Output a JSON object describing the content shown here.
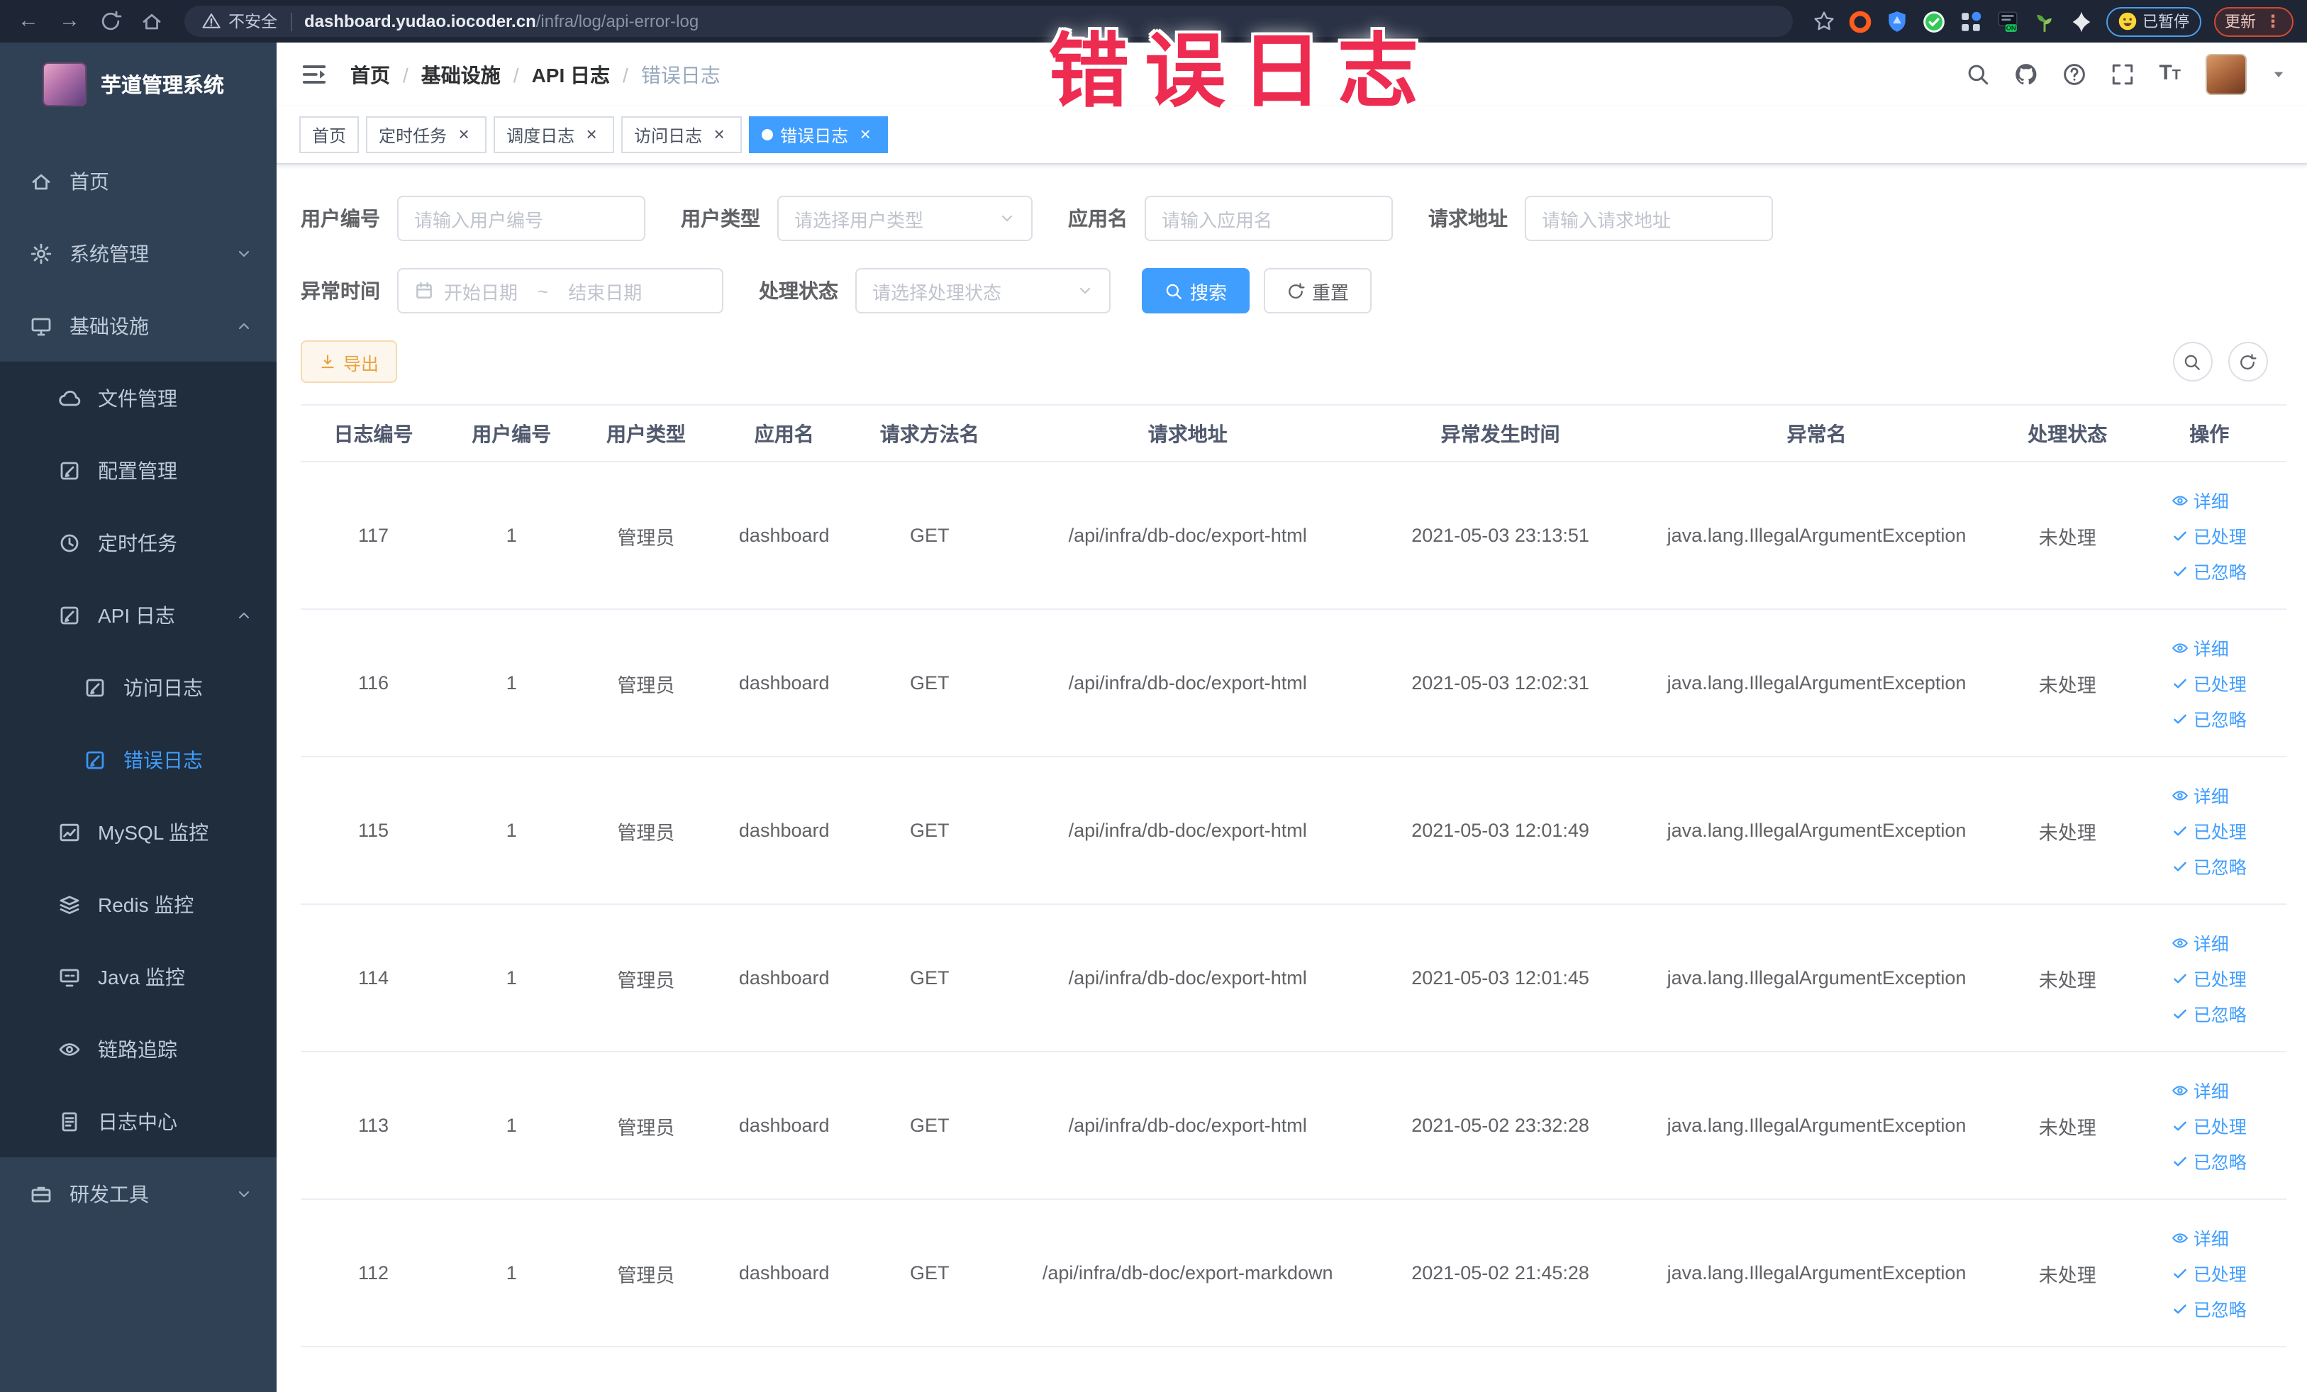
{
  "browser": {
    "security_label": "不安全",
    "url_host": "dashboard.yudao.iocoder.cn",
    "url_path": "/infra/log/api-error-log",
    "paused_label": "已暂停",
    "update_label": "更新"
  },
  "annotation": {
    "text": "错误日志",
    "color": "#ee2b50"
  },
  "sidebar": {
    "title": "芋道管理系统",
    "items": [
      {
        "label": "首页",
        "icon": "home-icon",
        "level": 0
      },
      {
        "label": "系统管理",
        "icon": "gear-icon",
        "level": 0,
        "arrow_down": true
      },
      {
        "label": "基础设施",
        "icon": "infra-icon",
        "level": 0,
        "arrow_up": true
      },
      {
        "label": "文件管理",
        "icon": "file-icon",
        "level": 1,
        "sub": true
      },
      {
        "label": "配置管理",
        "icon": "config-icon",
        "level": 1,
        "sub": true
      },
      {
        "label": "定时任务",
        "icon": "job-icon",
        "level": 1,
        "sub": true
      },
      {
        "label": "API 日志",
        "icon": "apilog-icon",
        "level": 1,
        "sub": true,
        "arrow_up": true
      },
      {
        "label": "访问日志",
        "icon": "accesslog-icon",
        "level": 2,
        "sub": true
      },
      {
        "label": "错误日志",
        "icon": "errorlog-icon",
        "level": 2,
        "sub": true,
        "active": true
      },
      {
        "label": "MySQL 监控",
        "icon": "mysql-icon",
        "level": 1,
        "sub": true
      },
      {
        "label": "Redis 监控",
        "icon": "redis-icon",
        "level": 1,
        "sub": true
      },
      {
        "label": "Java 监控",
        "icon": "java-icon",
        "level": 1,
        "sub": true
      },
      {
        "label": "链路追踪",
        "icon": "trace-icon",
        "level": 1,
        "sub": true
      },
      {
        "label": "日志中心",
        "icon": "logcenter-icon",
        "level": 1,
        "sub": true
      },
      {
        "label": "研发工具",
        "icon": "tool-icon",
        "level": 0,
        "arrow_down": true
      }
    ]
  },
  "header": {
    "breadcrumb": [
      {
        "label": "首页",
        "sep": true
      },
      {
        "label": "基础设施",
        "sep": true
      },
      {
        "label": "API 日志",
        "sep": true
      },
      {
        "label": "错误日志",
        "last": true
      }
    ]
  },
  "tabs": [
    {
      "label": "首页"
    },
    {
      "label": "定时任务",
      "closable": true
    },
    {
      "label": "调度日志",
      "closable": true
    },
    {
      "label": "访问日志",
      "closable": true
    },
    {
      "label": "错误日志",
      "closable": true,
      "active": true
    }
  ],
  "filters": {
    "user_id": {
      "label": "用户编号",
      "placeholder": "请输入用户编号"
    },
    "user_type": {
      "label": "用户类型",
      "placeholder": "请选择用户类型"
    },
    "app_name": {
      "label": "应用名",
      "placeholder": "请输入应用名"
    },
    "request_url": {
      "label": "请求地址",
      "placeholder": "请输入请求地址"
    },
    "exception_time": {
      "label": "异常时间",
      "start_placeholder": "开始日期",
      "separator": "~",
      "end_placeholder": "结束日期"
    },
    "process_status": {
      "label": "处理状态",
      "placeholder": "请选择处理状态"
    },
    "search_label": "搜索",
    "reset_label": "重置"
  },
  "toolbar": {
    "export_label": "导出"
  },
  "table": {
    "columns": [
      "日志编号",
      "用户编号",
      "用户类型",
      "应用名",
      "请求方法名",
      "请求地址",
      "异常发生时间",
      "异常名",
      "处理状态",
      "操作"
    ],
    "actions": [
      "详细",
      "已处理",
      "已忽略"
    ],
    "rows": [
      {
        "id": "117",
        "user_id": "1",
        "user_type": "管理员",
        "app": "dashboard",
        "method": "GET",
        "url": "/api/infra/db-doc/export-html",
        "time": "2021-05-03 23:13:51",
        "exception": "java.lang.IllegalArgumentException",
        "status": "未处理"
      },
      {
        "id": "116",
        "user_id": "1",
        "user_type": "管理员",
        "app": "dashboard",
        "method": "GET",
        "url": "/api/infra/db-doc/export-html",
        "time": "2021-05-03 12:02:31",
        "exception": "java.lang.IllegalArgumentException",
        "status": "未处理"
      },
      {
        "id": "115",
        "user_id": "1",
        "user_type": "管理员",
        "app": "dashboard",
        "method": "GET",
        "url": "/api/infra/db-doc/export-html",
        "time": "2021-05-03 12:01:49",
        "exception": "java.lang.IllegalArgumentException",
        "status": "未处理"
      },
      {
        "id": "114",
        "user_id": "1",
        "user_type": "管理员",
        "app": "dashboard",
        "method": "GET",
        "url": "/api/infra/db-doc/export-html",
        "time": "2021-05-03 12:01:45",
        "exception": "java.lang.IllegalArgumentException",
        "status": "未处理"
      },
      {
        "id": "113",
        "user_id": "1",
        "user_type": "管理员",
        "app": "dashboard",
        "method": "GET",
        "url": "/api/infra/db-doc/export-html",
        "time": "2021-05-02 23:32:28",
        "exception": "java.lang.IllegalArgumentException",
        "status": "未处理"
      },
      {
        "id": "112",
        "user_id": "1",
        "user_type": "管理员",
        "app": "dashboard",
        "method": "GET",
        "url": "/api/infra/db-doc/export-markdown",
        "time": "2021-05-02 21:45:28",
        "exception": "java.lang.IllegalArgumentException",
        "status": "未处理"
      }
    ]
  }
}
